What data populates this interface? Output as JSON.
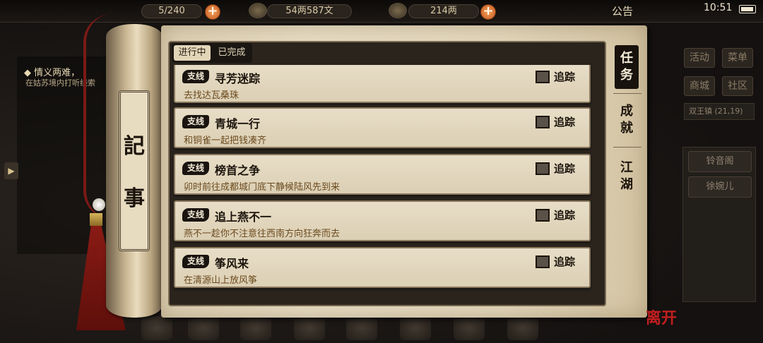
{
  "topbar": {
    "stamina": "5/240",
    "silver": "54两587文",
    "gold": "214两",
    "notice": "公告",
    "time": "10:51",
    "plus": "+"
  },
  "left_hint": {
    "title": "◆ 情义两难，",
    "text": "在姑苏境内打听线索"
  },
  "right_menu": {
    "items": [
      "活动",
      "菜单",
      "商城",
      "社区"
    ],
    "location": "双王镇 (21,19)",
    "npcs": [
      "铃音阁",
      "徐婉儿"
    ]
  },
  "scroll": {
    "char1": "記",
    "char2": "事"
  },
  "tabs": {
    "active": "进行中",
    "done": "已完成"
  },
  "side_tabs": [
    "任务",
    "成就",
    "江湖"
  ],
  "quests": [
    {
      "badge": "支线",
      "title": "寻芳迷踪",
      "desc": "去找达瓦桑珠",
      "track": "追踪"
    },
    {
      "badge": "支线",
      "title": "青城一行",
      "desc": "和铜雀一起把钱凑齐",
      "track": "追踪"
    },
    {
      "badge": "支线",
      "title": "榜首之争",
      "desc": "卯时前往成都城门底下静候陆风先到来",
      "track": "追踪"
    },
    {
      "badge": "支线",
      "title": "追上燕不一",
      "desc": "燕不一趁你不注意往西南方向狂奔而去",
      "track": "追踪"
    },
    {
      "badge": "支线",
      "title": "筝风来",
      "desc": "在清源山上放风筝",
      "track": "追踪"
    }
  ],
  "leave": "离开",
  "colors": {
    "accent": "#c21e1e",
    "paper": "#e8ddc5",
    "dark": "#1c140c"
  }
}
